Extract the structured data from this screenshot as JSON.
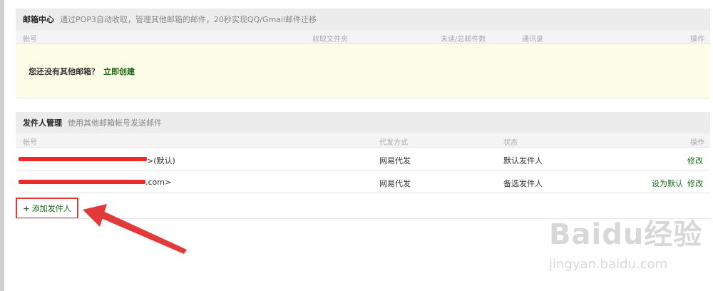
{
  "mailbox": {
    "title": "邮箱中心",
    "desc": "通过POP3自动收取，管理其他邮箱的邮件，20秒实现QQ/Gmail邮件迁移",
    "columns": [
      "帐号",
      "收取文件夹",
      "未读/总邮件数",
      "通讯录",
      "操作"
    ],
    "empty_text": "您还没有其他邮箱？",
    "create_link": "立即创建"
  },
  "senders": {
    "title": "发件人管理",
    "desc": "使用其他邮箱帐号发送邮件",
    "columns": [
      "帐号",
      "代发方式",
      "状态",
      "操作"
    ],
    "rows": [
      {
        "account_suffix": ">(默认)",
        "method": "网易代发",
        "status": "默认发件人",
        "set_default": "",
        "edit": "修改"
      },
      {
        "account_suffix": ".com>",
        "method": "网易代发",
        "status": "备选发件人",
        "set_default": "设为默认",
        "edit": "修改"
      }
    ],
    "add_button": "添加发件人",
    "add_plus": "+"
  },
  "watermark": {
    "brand": "Baidu经验",
    "url": "jingyan.baidu.com"
  },
  "colors": {
    "accent_green": "#1a6a1a",
    "highlight_red": "#e23a3a"
  }
}
